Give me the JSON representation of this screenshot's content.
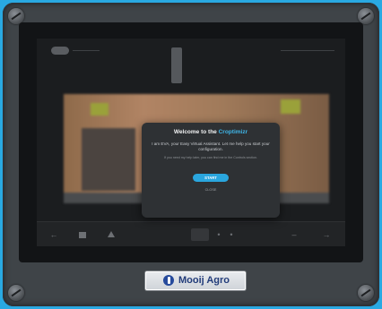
{
  "dialog": {
    "title_prefix": "Welcome to the ",
    "title_brand": "Croptimizr",
    "intro": "I am EVA, your Easy Virtual Assistant. Let me help you start your configuration.",
    "hint": "If you need my help later, you can find me in the Controls section.",
    "start_label": "START",
    "close_label": "CLOSE"
  },
  "nameplate": {
    "brand": "Mooij Agro"
  },
  "colors": {
    "background": "#29a9e2",
    "accent": "#2aa6de",
    "brand_blue": "#264a9c"
  }
}
